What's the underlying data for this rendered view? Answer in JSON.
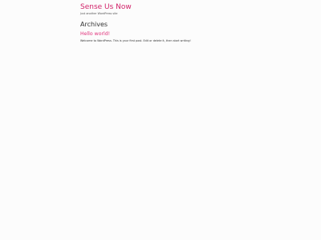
{
  "site": {
    "title": "Sense Us Now",
    "tagline": "Just another WordPress site"
  },
  "archive": {
    "heading": "Archives"
  },
  "posts": [
    {
      "title": "Hello world!",
      "excerpt": "Welcome to WordPress. This is your first post. Edit or delete it, then start writing!"
    }
  ],
  "colors": {
    "accent": "#d1246a",
    "background": "#fcfcfc",
    "text": "#333333"
  }
}
